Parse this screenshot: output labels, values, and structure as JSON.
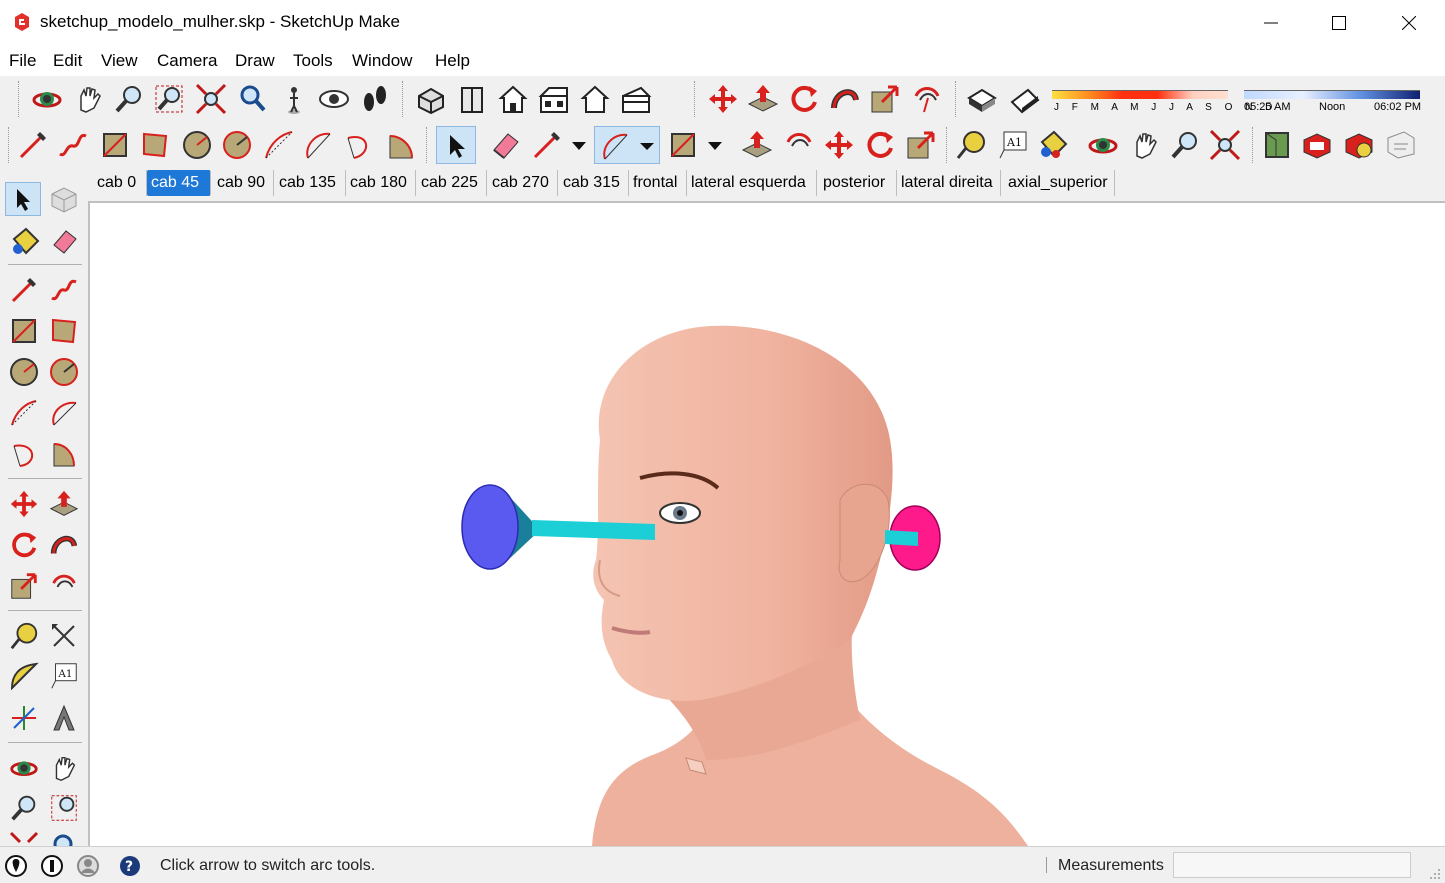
{
  "window": {
    "title": "sketchup_modelo_mulher.skp - SketchUp Make",
    "minimize": "—",
    "maximize": "☐",
    "close": "✕"
  },
  "menu": [
    "File",
    "Edit",
    "View",
    "Camera",
    "Draw",
    "Tools",
    "Window",
    "Help"
  ],
  "scenes": {
    "active_index": 1,
    "tabs": [
      "cab 0",
      "cab 45",
      "cab 90",
      "cab 135",
      "cab 180",
      "cab 225",
      "cab 270",
      "cab 315",
      "frontal",
      "lateral esquerda",
      "posterior",
      "lateral direita",
      "axial_superior"
    ]
  },
  "shadows": {
    "months": "J F M A M J J A S O N D",
    "time_start": "05:25 AM",
    "time_mid": "Noon",
    "time_end": "06:02 PM"
  },
  "status": {
    "message": "Click arrow to switch arc tools.",
    "measurements_label": "Measurements",
    "measurements_value": ""
  },
  "colors": {
    "accent": "#1e78d7",
    "skin": "#f2b7a4",
    "blue_cone": "#5a5af0",
    "cyan_rod": "#1ccfd6",
    "magenta_disc": "#ff1a8c",
    "icon_red": "#d8201c"
  },
  "icons": {
    "row1": [
      "orbit-icon",
      "pan-icon",
      "zoom-icon",
      "zoom-window-icon",
      "zoom-extents-icon",
      "previous-view-icon",
      "position-camera-icon",
      "look-around-icon",
      "walk-icon",
      "iso-view-icon",
      "top-view-icon",
      "front-view-icon",
      "right-view-icon",
      "back-view-icon",
      "left-view-icon",
      "move-icon",
      "push-pull-icon",
      "rotate-icon",
      "follow-me-icon",
      "scale-icon",
      "offset-icon",
      "display-shadows-icon",
      "fog-icon"
    ],
    "row2": [
      "line-icon",
      "freehand-icon",
      "rectangle-icon",
      "rotated-rectangle-icon",
      "circle-icon",
      "polygon-icon",
      "arc-icon",
      "arc-2pt-icon",
      "arc-3pt-icon",
      "pie-icon",
      "select-icon",
      "eraser-icon",
      "pencil-icon",
      "dropdown-icon",
      "arc-tool-icon",
      "dropdown-icon",
      "rectangle-tool-icon",
      "dropdown-icon",
      "push-pull-icon",
      "offset-icon",
      "move-icon",
      "rotate-icon",
      "scale-icon",
      "tape-measure-icon",
      "text-icon",
      "paint-bucket-icon",
      "orbit-icon",
      "pan-icon",
      "zoom-icon",
      "zoom-extents-icon",
      "3d-warehouse-icon",
      "extension-warehouse-icon",
      "extension-manager-icon",
      "layout-icon"
    ]
  }
}
